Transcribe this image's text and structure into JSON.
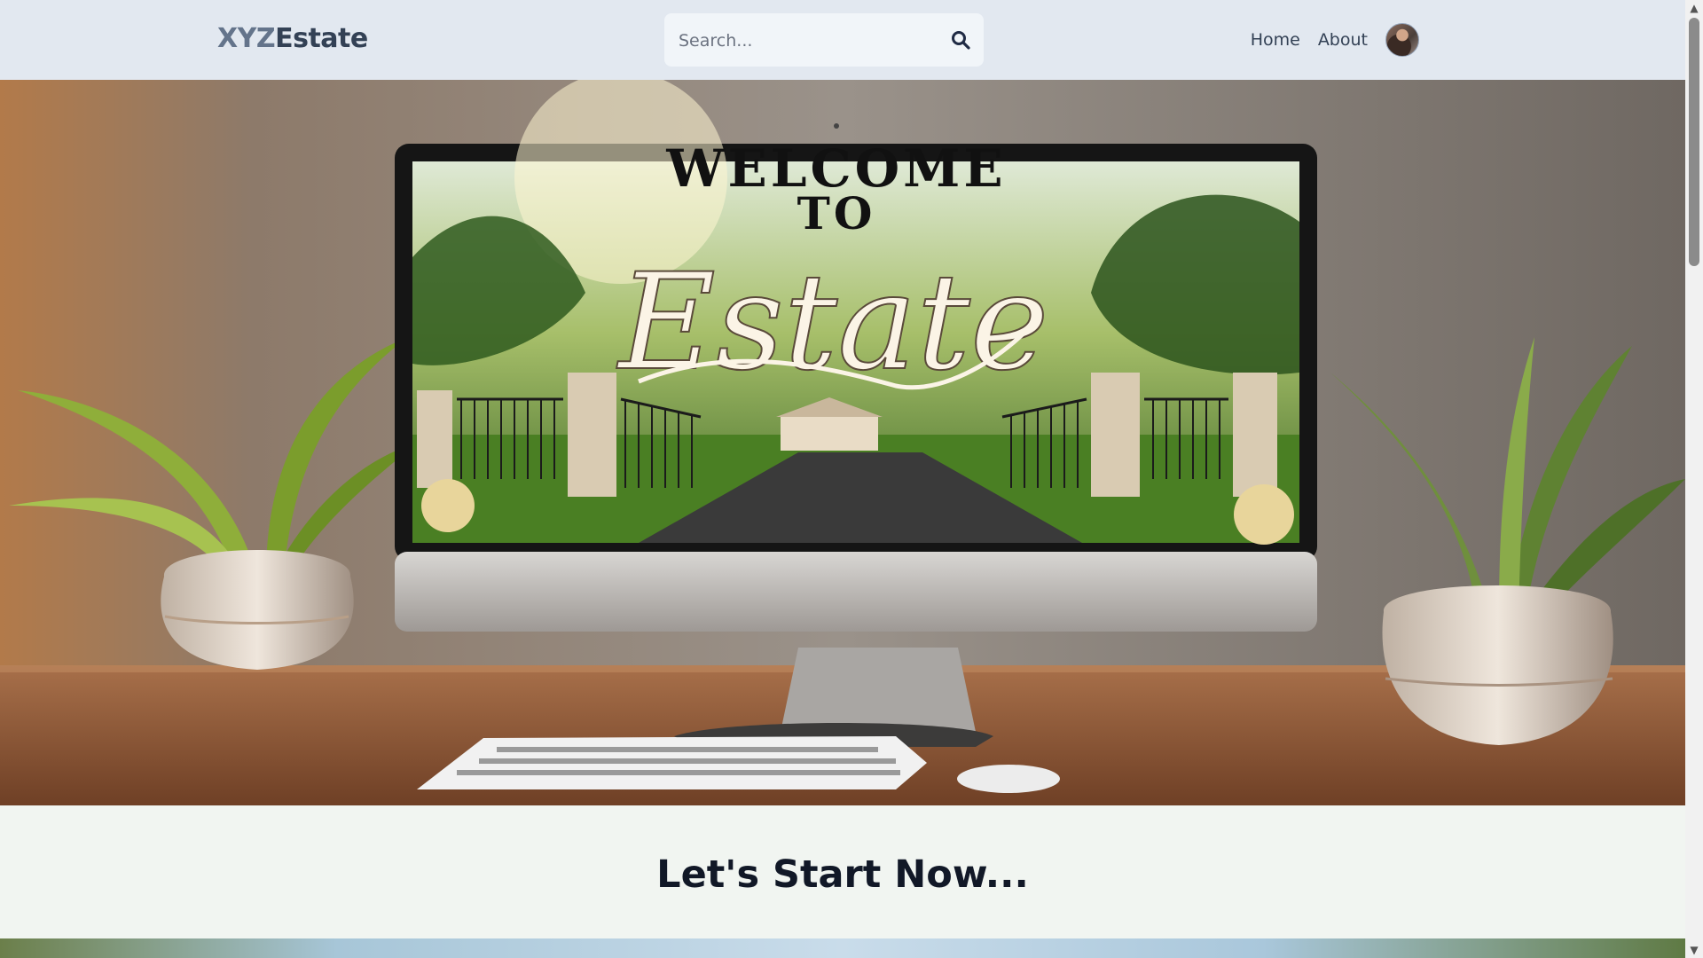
{
  "header": {
    "logo_part1": "XYZ",
    "logo_part2": "Estate",
    "search_placeholder": "Search...",
    "nav": {
      "home": "Home",
      "about": "About"
    }
  },
  "hero": {
    "screen_line1": "WELCOME",
    "screen_line2": "TO",
    "screen_script": "Estate"
  },
  "section": {
    "title": "Let's Start Now..."
  },
  "colors": {
    "header_bg": "#e2e8f0",
    "logo_light": "#64748b",
    "logo_dark": "#334155",
    "page_bg": "#f1f5f1"
  },
  "icons": {
    "search": "search-icon",
    "avatar": "avatar"
  }
}
